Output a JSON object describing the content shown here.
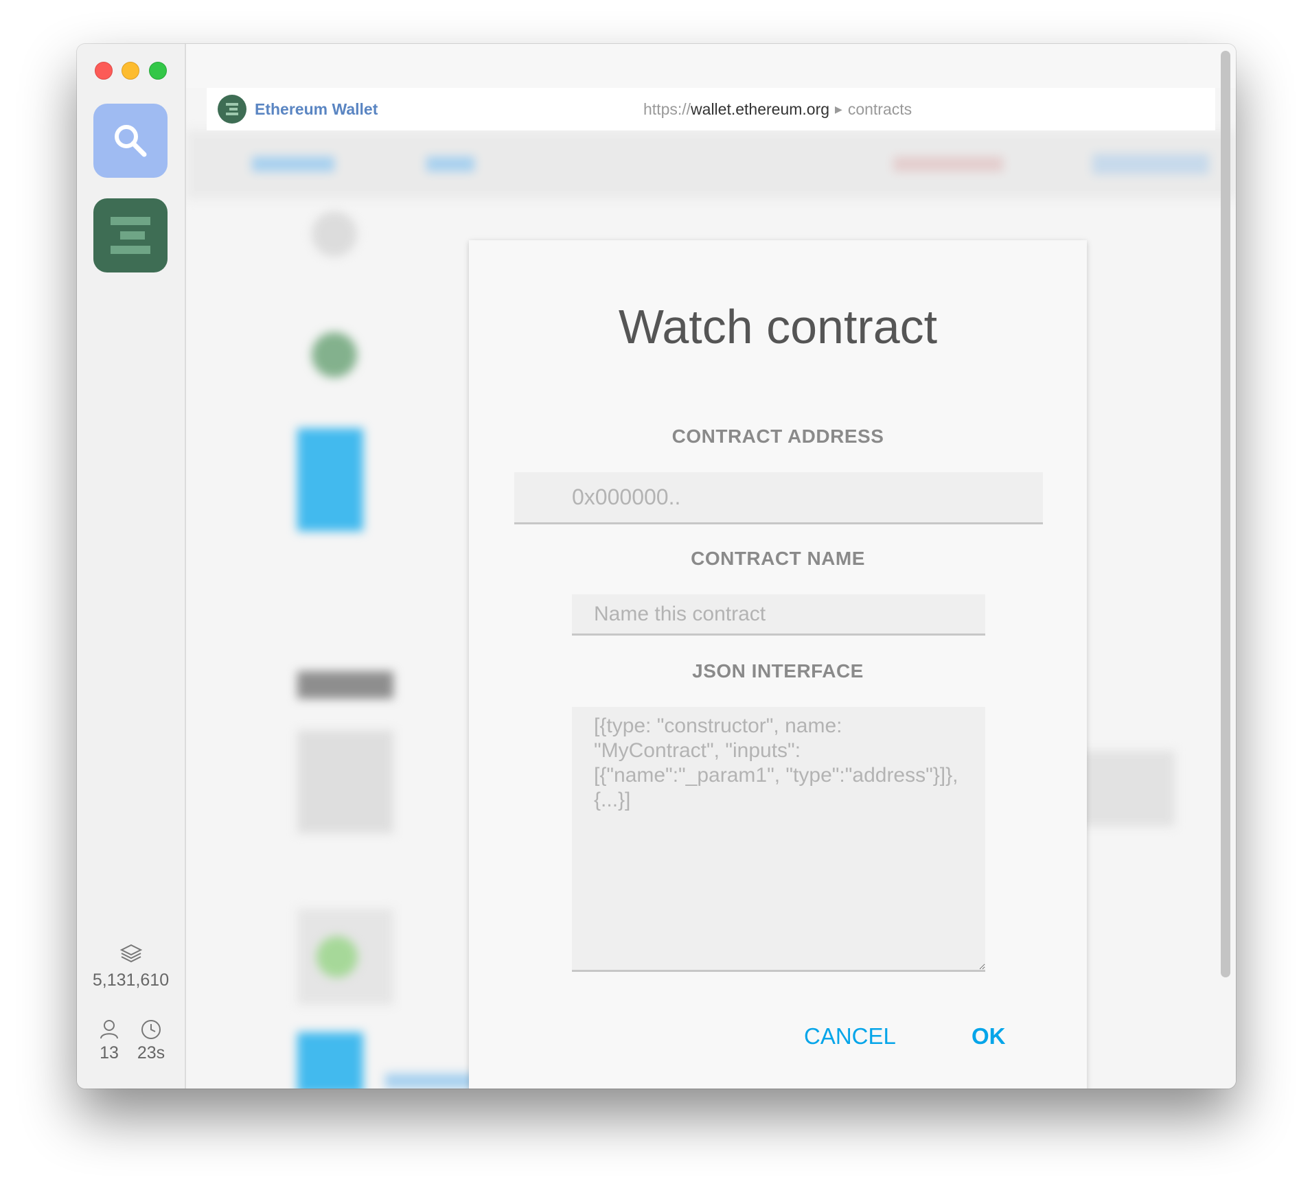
{
  "sidebar": {
    "block_number": "5,131,610",
    "peers": "13",
    "last_block": "23s"
  },
  "urlbar": {
    "site_name": "Ethereum Wallet",
    "url_scheme": "https://",
    "url_host": "wallet.ethereum.org",
    "url_path": "contracts"
  },
  "modal": {
    "title": "Watch contract",
    "address_label": "CONTRACT ADDRESS",
    "address_placeholder": "0x000000..",
    "name_label": "CONTRACT NAME",
    "name_placeholder": "Name this contract",
    "json_label": "JSON INTERFACE",
    "json_placeholder": "[{type: \"constructor\", name: \"MyContract\", \"inputs\": [{\"name\":\"_param1\", \"type\":\"address\"}]}, {...}]",
    "cancel_label": "CANCEL",
    "ok_label": "OK"
  },
  "colors": {
    "accent": "#05a5e9",
    "brand": "#3e6d54"
  }
}
